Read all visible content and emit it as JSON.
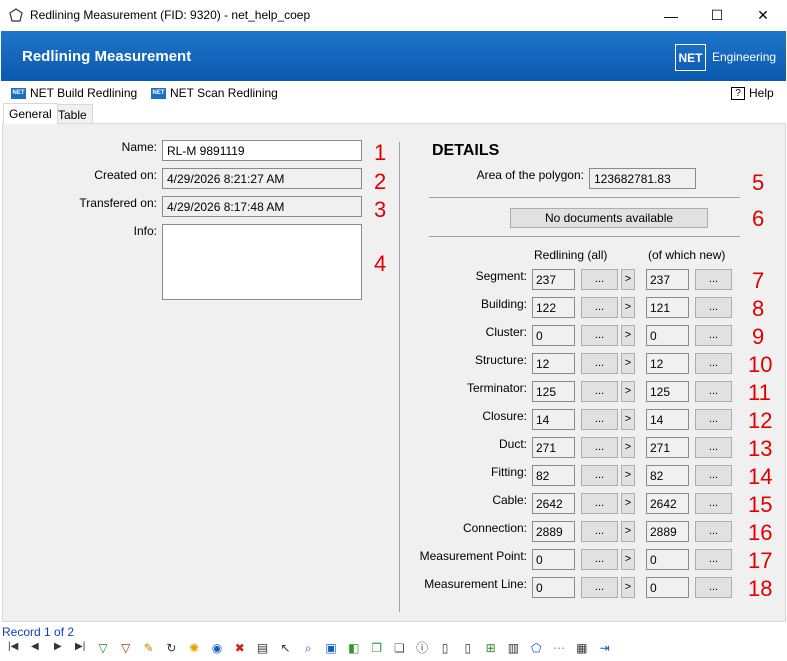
{
  "window": {
    "title": "Redlining Measurement (FID: 9320) - net_help_coep",
    "minimize_glyph": "—",
    "maximize_glyph": "☐",
    "close_glyph": "✕"
  },
  "banner": {
    "title": "Redlining Measurement",
    "logo_text": "NET",
    "brand_text": "Engineering",
    "brand_color": "#0a5aaf"
  },
  "toolbar": {
    "build_label": "NET Build Redlining",
    "scan_label": "NET Scan Redlining",
    "help_label": "Help",
    "net_badge": "NET",
    "help_glyph": "?"
  },
  "tabs": [
    {
      "label": "General",
      "active": true
    },
    {
      "label": "Table",
      "active": false
    }
  ],
  "general": {
    "name_label": "Name:",
    "name_value": "RL-M 9891119",
    "created_label": "Created on:",
    "created_value": "4/29/2026 8:21:27 AM",
    "transfered_label": "Transfered on:",
    "transfered_value": "4/29/2026 8:17:48 AM",
    "info_label": "Info:",
    "info_value": ""
  },
  "details": {
    "heading": "DETAILS",
    "area_label": "Area of the polygon:",
    "area_value": "123682781.83",
    "docs_button": "No documents available",
    "col_all": "Redlining (all)",
    "col_new": "(of which new)",
    "dots_label": "...",
    "arrow_label": ">",
    "rows": [
      {
        "label": "Segment:",
        "all": "237",
        "new": "237"
      },
      {
        "label": "Building:",
        "all": "122",
        "new": "121"
      },
      {
        "label": "Cluster:",
        "all": "0",
        "new": "0"
      },
      {
        "label": "Structure:",
        "all": "12",
        "new": "12"
      },
      {
        "label": "Terminator:",
        "all": "125",
        "new": "125"
      },
      {
        "label": "Closure:",
        "all": "14",
        "new": "14"
      },
      {
        "label": "Duct:",
        "all": "271",
        "new": "271"
      },
      {
        "label": "Fitting:",
        "all": "82",
        "new": "82"
      },
      {
        "label": "Cable:",
        "all": "2642",
        "new": "2642"
      },
      {
        "label": "Connection:",
        "all": "2889",
        "new": "2889"
      },
      {
        "label": "Measurement Point:",
        "all": "0",
        "new": "0"
      },
      {
        "label": "Measurement Line:",
        "all": "0",
        "new": "0"
      }
    ]
  },
  "callouts": [
    "1",
    "2",
    "3",
    "4",
    "5",
    "6",
    "7",
    "8",
    "9",
    "10",
    "11",
    "12",
    "13",
    "14",
    "15",
    "16",
    "17",
    "18"
  ],
  "status": {
    "record_text": "Record 1 of 2",
    "nav": [
      "|◀",
      "◀",
      "▶",
      "▶|"
    ],
    "tools": [
      {
        "icon": "filter-add-icon",
        "glyph": "▽",
        "color": "#2a8a2a"
      },
      {
        "icon": "filter-remove-icon",
        "glyph": "▽",
        "color": "#c02020"
      },
      {
        "icon": "pencil-icon",
        "glyph": "✎",
        "color": "#d08000"
      },
      {
        "icon": "refresh-icon",
        "glyph": "↻",
        "color": "#333333"
      },
      {
        "icon": "sun-icon",
        "glyph": "✺",
        "color": "#e0a000"
      },
      {
        "icon": "globe-icon",
        "glyph": "◉",
        "color": "#1060c0"
      },
      {
        "icon": "delete-icon",
        "glyph": "✖",
        "color": "#d02020"
      },
      {
        "icon": "print-icon",
        "glyph": "▤",
        "color": "#333333"
      },
      {
        "icon": "select-icon",
        "glyph": "↖",
        "color": "#333333"
      },
      {
        "icon": "zoom-icon",
        "glyph": "⌕",
        "color": "#1060c0"
      },
      {
        "icon": "select-box-icon",
        "glyph": "▣",
        "color": "#1060c0"
      },
      {
        "icon": "shape-icon",
        "glyph": "◧",
        "color": "#2a9a2a"
      },
      {
        "icon": "copy-icon",
        "glyph": "❐",
        "color": "#2a9a2a"
      },
      {
        "icon": "layers-icon",
        "glyph": "❏",
        "color": "#555555"
      },
      {
        "icon": "info-icon",
        "glyph": "ⓘ",
        "color": "#333333"
      },
      {
        "icon": "document-icon",
        "glyph": "▯",
        "color": "#333333"
      },
      {
        "icon": "page-icon",
        "glyph": "▯",
        "color": "#333333"
      },
      {
        "icon": "add-document-icon",
        "glyph": "⊞",
        "color": "#2a8a2a"
      },
      {
        "icon": "report-icon",
        "glyph": "▥",
        "color": "#333333"
      },
      {
        "icon": "pentagon-icon",
        "glyph": "⬠",
        "color": "#1060c0"
      },
      {
        "icon": "connect-icon",
        "glyph": "⋯",
        "color": "#888888"
      },
      {
        "icon": "table-icon",
        "glyph": "▦",
        "color": "#333333"
      },
      {
        "icon": "exit-icon",
        "glyph": "⇥",
        "color": "#1060c0"
      }
    ]
  }
}
